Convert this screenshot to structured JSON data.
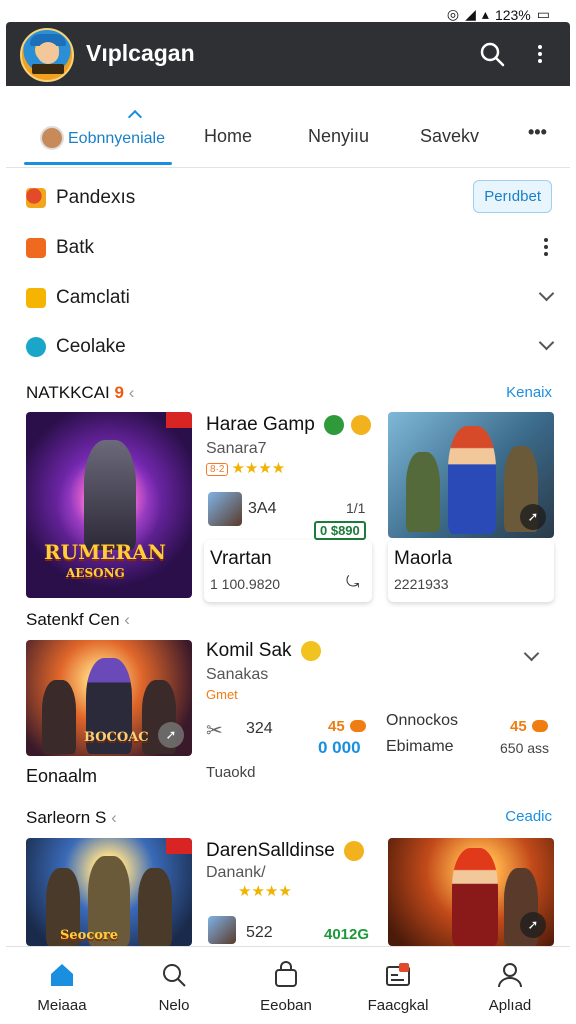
{
  "status": {
    "battery": "123%"
  },
  "app": {
    "title": "Vıplcagan"
  },
  "tabs": [
    {
      "label": "Eobnnyeniale"
    },
    {
      "label": "Home"
    },
    {
      "label": "Nenyiıu"
    },
    {
      "label": "Savekv"
    }
  ],
  "menu": [
    {
      "label": "Pandexıs",
      "action": "Perıdbet"
    },
    {
      "label": "Batk"
    },
    {
      "label": "Camclati"
    },
    {
      "label": "Ceolake"
    }
  ],
  "section1": {
    "heading": "NATKKCAI",
    "heading_suffix": "9",
    "link": "Kenaix",
    "feature": {
      "banner_line1": "RUMERAN",
      "banner_line2": "AESONG"
    },
    "game_title": "Harae Gamp",
    "game_sub": "Sanara7",
    "rating_tag": "8·2",
    "rating_stars": "★★★★",
    "mini_value": "3A4",
    "mini_count": "1/1",
    "mini_badge": "0 $890",
    "card1": {
      "title": "Vrartan",
      "value": "1 100.9820"
    },
    "card2": {
      "title": "Maorla",
      "value": "2221933"
    }
  },
  "section2": {
    "heading": "Satenkf Cen",
    "thumb_text": "BOCOAC",
    "caption": "Eonaalm",
    "game_title": "Komil Sak",
    "game_sub": "Sanakas",
    "game_tag": "Gmet",
    "stat_value": "324",
    "orange_a": "45",
    "blue_a": "0 000",
    "note": "Tuaokd",
    "right_title": "Onnockos",
    "orange_b": "45",
    "right_sub": "Ebimame",
    "right_value": "650 ass"
  },
  "section3": {
    "heading": "Sarleorn S",
    "link": "Ceadic",
    "thumb_text": "Seocore",
    "game_title": "DarenSalldinse",
    "game_sub": "Danank/",
    "rating_stars": "★★★★",
    "stat_value": "522",
    "green_value": "4012G"
  },
  "nav": [
    {
      "label": "Meiaaa",
      "icon": "home-icon",
      "active": true
    },
    {
      "label": "Nelo",
      "icon": "search-icon"
    },
    {
      "label": "Eeoban",
      "icon": "bag-icon"
    },
    {
      "label": "Faacgkal",
      "icon": "notification-icon"
    },
    {
      "label": "Aplıad",
      "icon": "profile-icon"
    }
  ],
  "colors": {
    "appbar": "#2e3033",
    "accent": "#1a8fe0",
    "star": "#f2b200",
    "orange": "#ef7d12"
  }
}
